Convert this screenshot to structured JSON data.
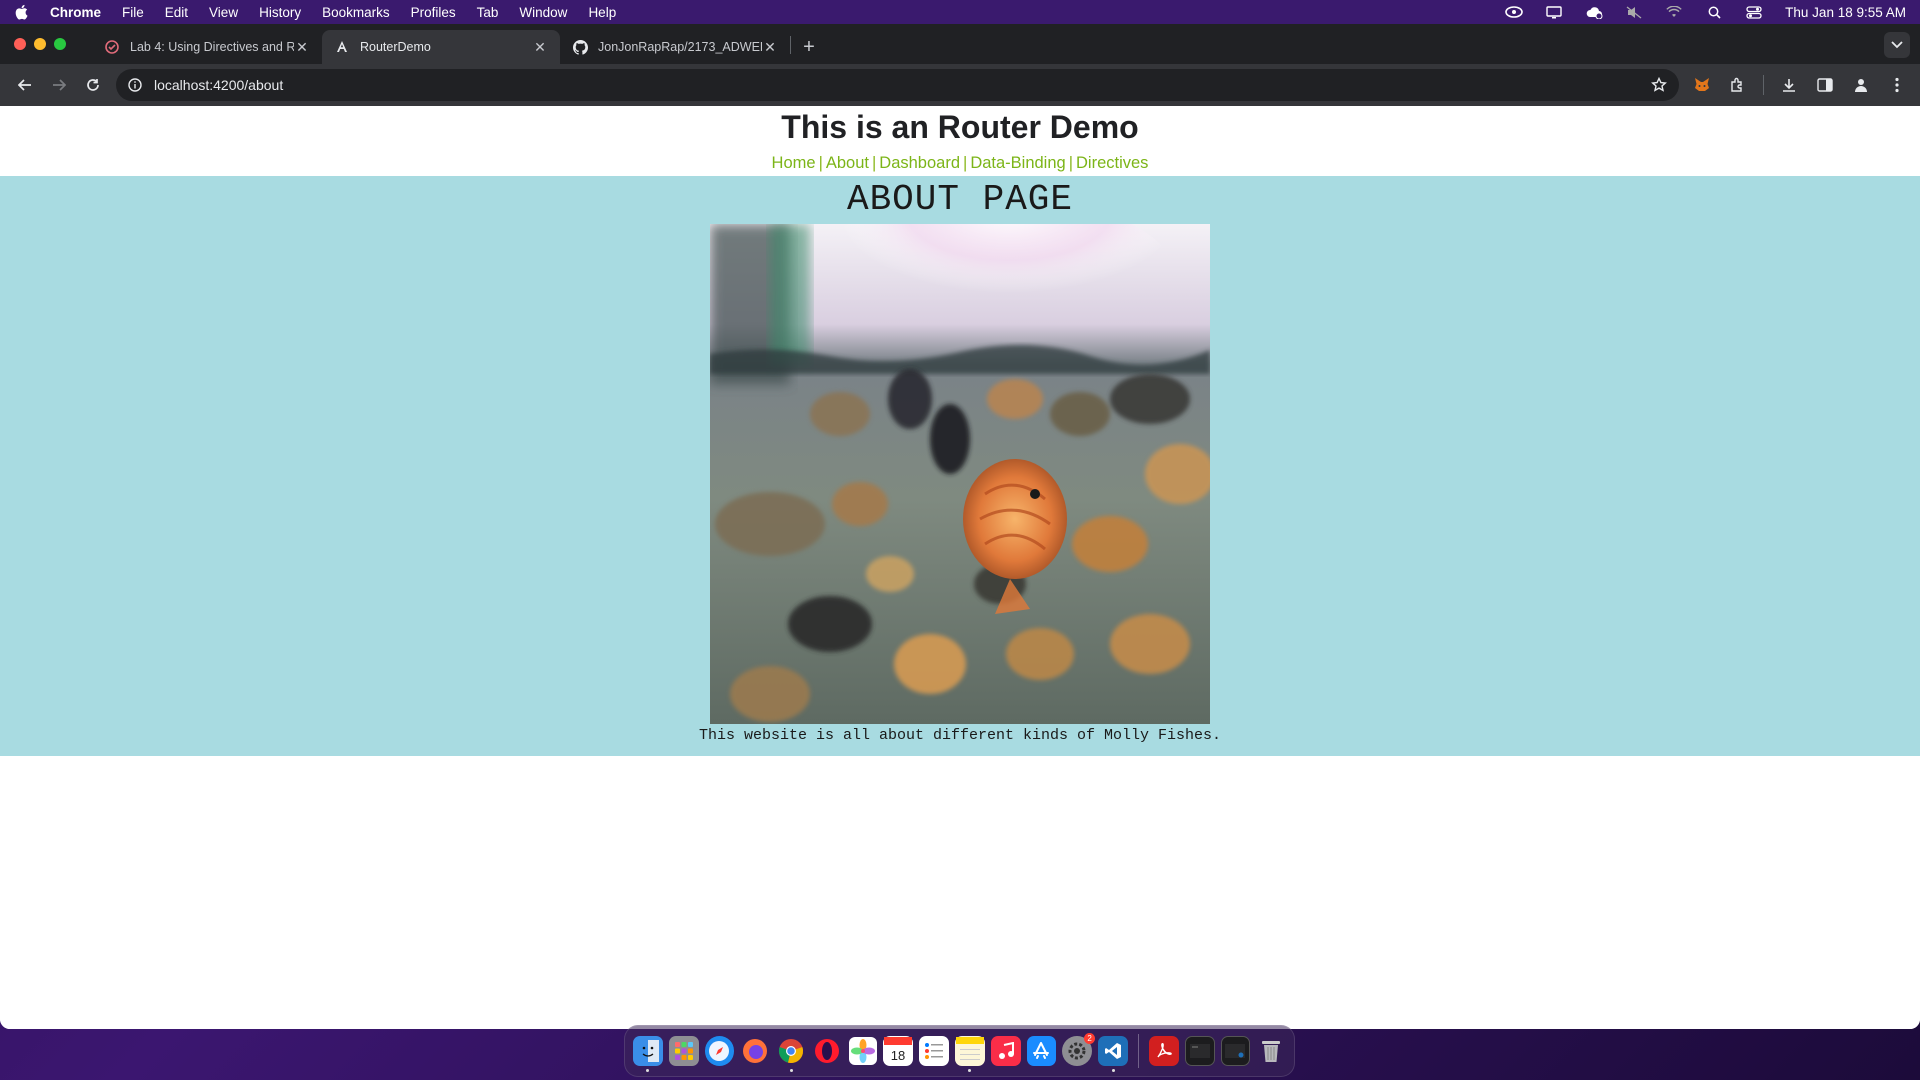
{
  "menubar": {
    "app_name": "Chrome",
    "items": [
      "File",
      "Edit",
      "View",
      "History",
      "Bookmarks",
      "Profiles",
      "Tab",
      "Window",
      "Help"
    ],
    "clock": "Thu Jan 18  9:55 AM"
  },
  "tabs": [
    {
      "title": "Lab 4: Using Directives and R",
      "favicon": "lab-icon",
      "active": false
    },
    {
      "title": "RouterDemo",
      "favicon": "angular-icon",
      "active": true
    },
    {
      "title": "JonJonRapRap/2173_ADWEB",
      "favicon": "github-icon",
      "active": false
    }
  ],
  "toolbar": {
    "url": "localhost:4200/about"
  },
  "page": {
    "title": "This is an Router Demo",
    "nav": [
      "Home",
      "About",
      "Dashboard",
      "Data-Binding",
      "Directives"
    ],
    "separator": "|",
    "heading": "ABOUT PAGE",
    "image_alt": "Molly fishes in an aquarium",
    "caption": "This website is all about different kinds of Molly Fishes."
  },
  "colors": {
    "section_bg": "#a8dbe1",
    "link": "#7cb518",
    "menubar": "#3a1a6e"
  }
}
